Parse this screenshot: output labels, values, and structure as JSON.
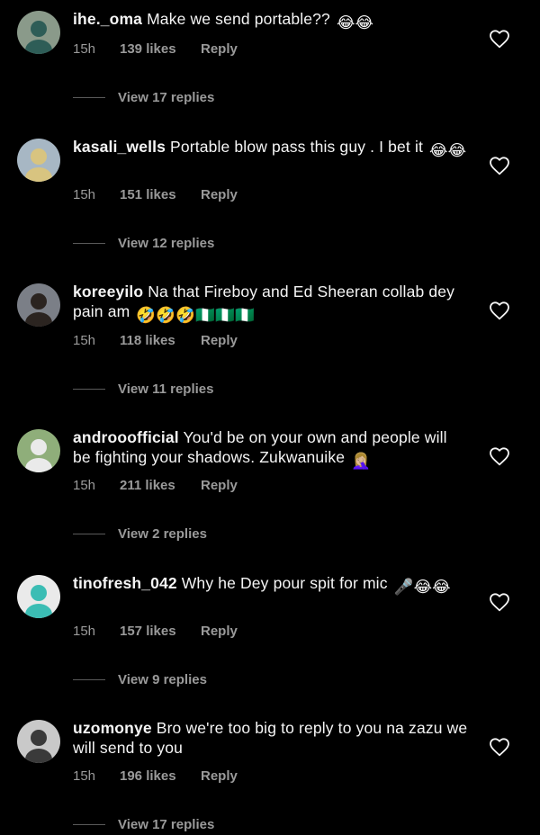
{
  "comments": [
    {
      "username": "ihe._oma",
      "text": "Make we send portable??",
      "emoji": "😂😂",
      "time": "15h",
      "likes": "139 likes",
      "reply": "Reply",
      "view_replies": "View 17 replies",
      "avatar": {
        "bg": "#8a9a8a",
        "fg": "#2e5d57"
      }
    },
    {
      "username": "kasali_wells",
      "text": "Portable blow pass this guy . I bet it",
      "emoji": "😂😂",
      "time": "15h",
      "likes": "151 likes",
      "reply": "Reply",
      "view_replies": "View 12 replies",
      "avatar": {
        "bg": "#a7b7c4",
        "fg": "#d8c480"
      }
    },
    {
      "username": "koreeyilo",
      "text": "Na that Fireboy and Ed Sheeran collab dey pain am",
      "emoji": "🤣🤣🤣🇳🇬🇳🇬🇳🇬",
      "time": "15h",
      "likes": "118 likes",
      "reply": "Reply",
      "view_replies": "View 11 replies",
      "avatar": {
        "bg": "#7b7f87",
        "fg": "#2b2420"
      }
    },
    {
      "username": "androoofficial",
      "text": "You'd be on your own and people will be fighting your shadows. Zukwanuike",
      "emoji": "🤦🏼‍♀️",
      "time": "15h",
      "likes": "211 likes",
      "reply": "Reply",
      "view_replies": "View 2 replies",
      "avatar": {
        "bg": "#8fae7a",
        "fg": "#eaeaea"
      }
    },
    {
      "username": "tinofresh_042",
      "text": "Why he Dey pour spit for mic",
      "emoji": "🎤😂😂",
      "time": "15h",
      "likes": "157 likes",
      "reply": "Reply",
      "view_replies": "View 9 replies",
      "avatar": {
        "bg": "#eaeaea",
        "fg": "#3bbdb4"
      }
    },
    {
      "username": "uzomonye",
      "text": "Bro we're too big to reply to you na zazu we will send to you",
      "emoji": "",
      "time": "15h",
      "likes": "196 likes",
      "reply": "Reply",
      "view_replies": "View 17 replies",
      "avatar": {
        "bg": "#c9c9c9",
        "fg": "#3a3a3a"
      }
    }
  ]
}
